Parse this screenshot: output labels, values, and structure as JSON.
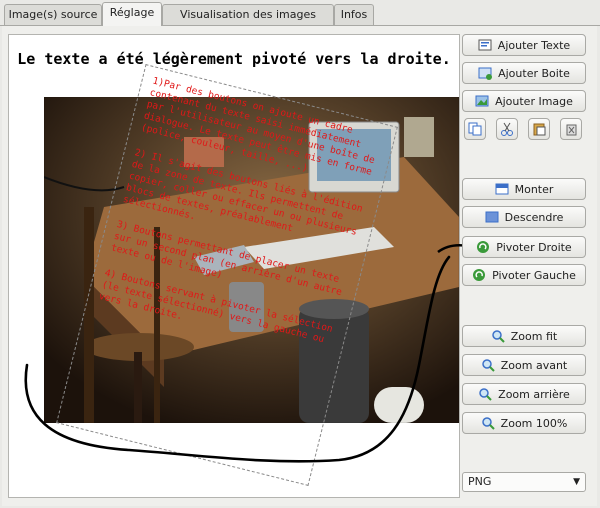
{
  "tabs": [
    {
      "label": "Image(s) source",
      "active": false
    },
    {
      "label": "Réglage",
      "active": true
    },
    {
      "label": "Visualisation des images créées",
      "active": false
    },
    {
      "label": "Infos",
      "active": false
    }
  ],
  "canvas": {
    "title": "Le texte a été légèrement pivoté vers la droite.",
    "overlay_text": [
      "1)Par des boutons on ajoute un cadre contenant du texte saisi immédiatement par l'utilisateur au moyen d'une boîte de dialogue. Le texte peut être mis en forme (police, couleur, taille, ...)",
      "2) Il s'agit des boutons liés à l'édition de la zone de texte. Ils permettent de copier, coller ou effacer un ou plusieurs blocs de textes, préalablement sélectionnés.",
      "3) Boutons permettant de placer un texte sur un second plan (en arrière d'un autre texte ou de l'image)",
      "4) Boutons servant à pivoter la sélection (le texte sélectionné) vers la gauche ou vers la droite."
    ]
  },
  "sidebar": {
    "add_text": "Ajouter Texte",
    "add_box": "Ajouter Boite",
    "add_image": "Ajouter Image",
    "move_up": "Monter",
    "move_down": "Descendre",
    "rotate_right": "Pivoter Droite",
    "rotate_left": "Pivoter Gauche",
    "zoom_fit": "Zoom fit",
    "zoom_in": "Zoom avant",
    "zoom_out": "Zoom arrière",
    "zoom_100": "Zoom 100%",
    "format": "PNG"
  },
  "icons": [
    "text-icon",
    "box-icon",
    "image-icon",
    "copy-icon",
    "cut-icon",
    "paste-icon",
    "delete-icon",
    "up-icon",
    "down-icon",
    "rotate-right-icon",
    "rotate-left-icon",
    "zoom-icon"
  ],
  "colors": {
    "annotation_red": "#e01818",
    "accent_green": "#3a9a3a",
    "accent_blue": "#3b6fc8"
  }
}
